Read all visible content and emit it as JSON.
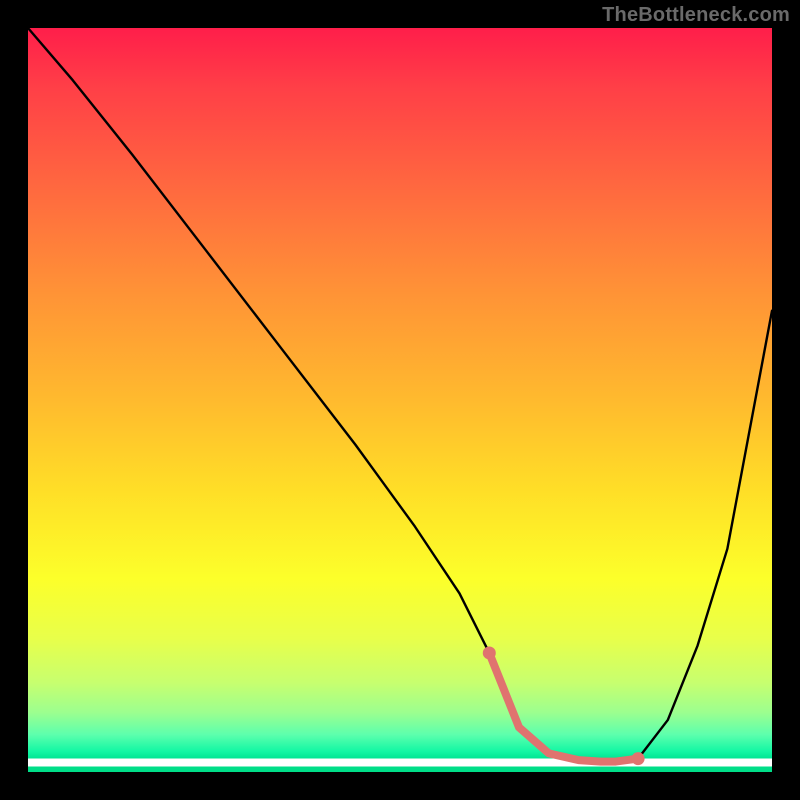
{
  "watermark": "TheBottleneck.com",
  "chart_data": {
    "type": "line",
    "title": "",
    "xlabel": "",
    "ylabel": "",
    "xlim": [
      0,
      100
    ],
    "ylim": [
      0,
      100
    ],
    "series": [
      {
        "name": "curve",
        "x": [
          0,
          6,
          14,
          24,
          34,
          44,
          52,
          58,
          62,
          64,
          66,
          70,
          74,
          77,
          79,
          82,
          86,
          90,
          94,
          100
        ],
        "values": [
          100,
          93,
          83,
          70,
          57,
          44,
          33,
          24,
          16,
          11,
          6,
          2.5,
          1.6,
          1.4,
          1.4,
          1.8,
          7,
          17,
          30,
          62
        ]
      }
    ],
    "highlight_segment": {
      "color": "#e0736f",
      "x": [
        62,
        64,
        66,
        70,
        74,
        77,
        79,
        82
      ],
      "values": [
        16,
        11,
        6,
        2.5,
        1.6,
        1.4,
        1.4,
        1.8
      ]
    },
    "highlight_dots": {
      "color": "#e0736f",
      "points": [
        {
          "x": 62,
          "y": 16
        },
        {
          "x": 82,
          "y": 1.8
        }
      ]
    },
    "background": "rainbow-vertical-gradient"
  }
}
